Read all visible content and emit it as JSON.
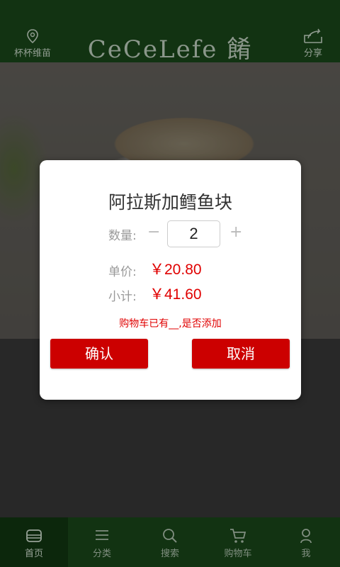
{
  "header": {
    "location_label": "杯杯维苗",
    "brand": "CeCeLefe 餚",
    "share_label": "分享"
  },
  "dialog": {
    "product_name": "阿拉斯加鳕鱼块",
    "quantity_label": "数量:",
    "minus_symbol": "−",
    "quantity_value": "2",
    "plus_symbol": "+",
    "unit_price_label": "单价:",
    "unit_price_value": "￥20.80",
    "subtotal_label": "小计:",
    "subtotal_value": "￥41.60",
    "notice": "购物车已有__,是否添加",
    "confirm_label": "确认",
    "cancel_label": "取消"
  },
  "bottom_nav": {
    "items": [
      {
        "label": "首页",
        "icon": "home-icon",
        "active": true
      },
      {
        "label": "分类",
        "icon": "list-icon",
        "active": false
      },
      {
        "label": "搜索",
        "icon": "search-icon",
        "active": false
      },
      {
        "label": "购物车",
        "icon": "cart-icon",
        "active": false
      },
      {
        "label": "我",
        "icon": "user-icon",
        "active": false
      }
    ]
  },
  "colors": {
    "header_green": "#1a4a1a",
    "accent_red": "#cc0000",
    "price_red": "#e00000"
  }
}
